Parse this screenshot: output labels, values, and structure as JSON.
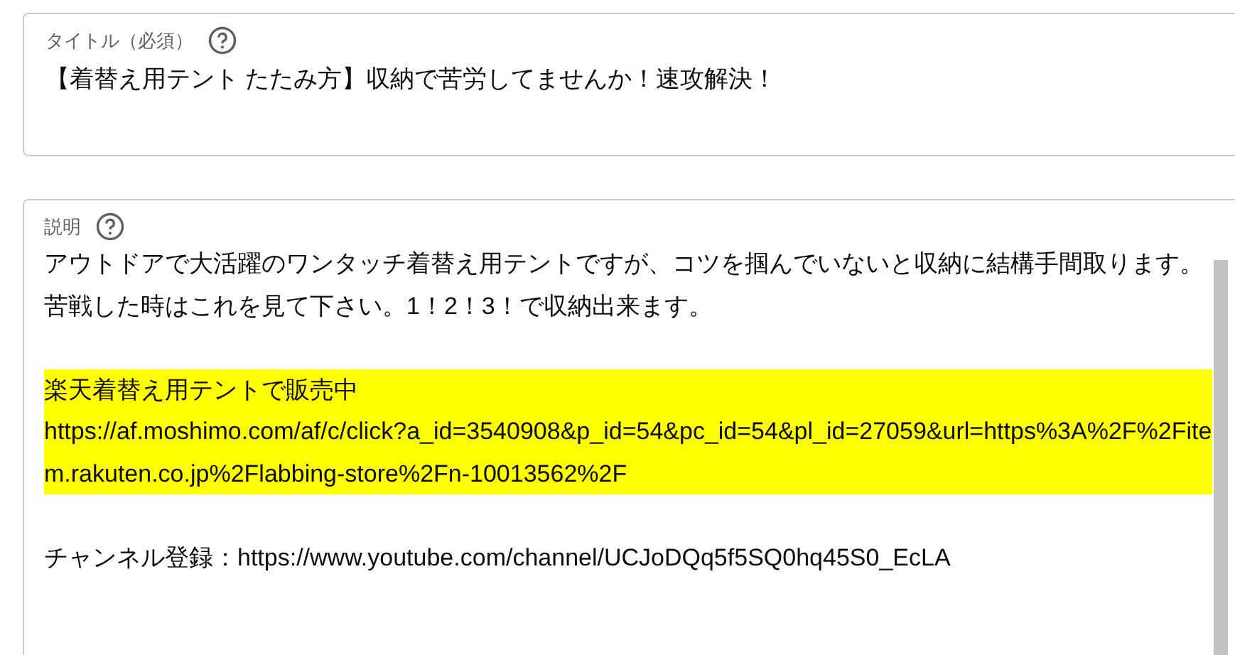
{
  "title_field": {
    "label": "タイトル（必須）",
    "value": "【着替え用テント たたみ方】収納で苦労してませんか！速攻解決！"
  },
  "description_field": {
    "label": "説明",
    "paragraphs": [
      {
        "highlighted": false,
        "lines": [
          "アウトドアで大活躍のワンタッチ着替え用テントですが、コツを掴んでいないと収納に結構手間取ります。苦戦した時はこれを見て下さい。1！2！3！で収納出来ます。"
        ]
      },
      {
        "highlighted": true,
        "lines": [
          "楽天着替え用テントで販売中",
          "https://af.moshimo.com/af/c/click?a_id=3540908&p_id=54&pc_id=54&pl_id=27059&url=https%3A%2F%2Fitem.rakuten.co.jp%2Flabbing-store%2Fn-10013562%2F"
        ]
      },
      {
        "highlighted": false,
        "lines": [
          "チャンネル登録：https://www.youtube.com/channel/UCJoDQq5f5SQ0hq45S0_EcLA"
        ]
      }
    ]
  }
}
